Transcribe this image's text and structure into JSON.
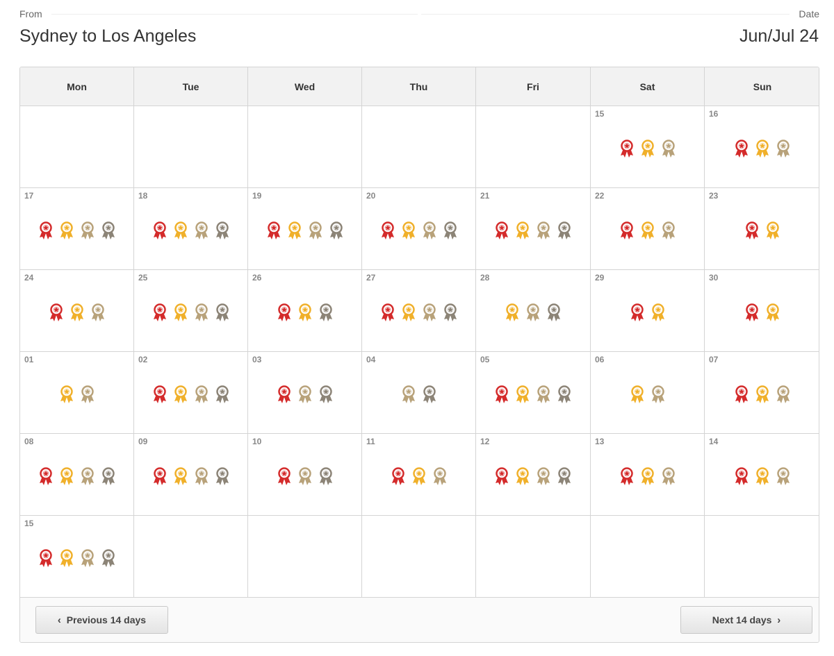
{
  "header": {
    "from_label": "From",
    "date_label": "Date",
    "route": "Sydney to Los Angeles",
    "period": "Jun/Jul 24"
  },
  "weekdays": [
    "Mon",
    "Tue",
    "Wed",
    "Thu",
    "Fri",
    "Sat",
    "Sun"
  ],
  "award_colors": {
    "first": "#d42b2b",
    "business": "#f0b02a",
    "premium": "#b8a27a",
    "economy": "#8c8477"
  },
  "award_icons": {
    "first": "award-red-icon",
    "business": "award-gold-icon",
    "premium": "award-tan-icon",
    "economy": "award-grey-icon"
  },
  "weeks": [
    [
      null,
      null,
      null,
      null,
      null,
      {
        "day": "15",
        "awards": [
          "first",
          "business",
          "premium"
        ]
      },
      {
        "day": "16",
        "awards": [
          "first",
          "business",
          "premium"
        ]
      }
    ],
    [
      {
        "day": "17",
        "awards": [
          "first",
          "business",
          "premium",
          "economy"
        ]
      },
      {
        "day": "18",
        "awards": [
          "first",
          "business",
          "premium",
          "economy"
        ]
      },
      {
        "day": "19",
        "awards": [
          "first",
          "business",
          "premium",
          "economy"
        ]
      },
      {
        "day": "20",
        "awards": [
          "first",
          "business",
          "premium",
          "economy"
        ]
      },
      {
        "day": "21",
        "awards": [
          "first",
          "business",
          "premium",
          "economy"
        ]
      },
      {
        "day": "22",
        "awards": [
          "first",
          "business",
          "premium"
        ]
      },
      {
        "day": "23",
        "awards": [
          "first",
          "business"
        ]
      }
    ],
    [
      {
        "day": "24",
        "awards": [
          "first",
          "business",
          "premium"
        ]
      },
      {
        "day": "25",
        "awards": [
          "first",
          "business",
          "premium",
          "economy"
        ]
      },
      {
        "day": "26",
        "awards": [
          "first",
          "business",
          "economy"
        ]
      },
      {
        "day": "27",
        "awards": [
          "first",
          "business",
          "premium",
          "economy"
        ]
      },
      {
        "day": "28",
        "awards": [
          "business",
          "premium",
          "economy"
        ]
      },
      {
        "day": "29",
        "awards": [
          "first",
          "business"
        ]
      },
      {
        "day": "30",
        "awards": [
          "first",
          "business"
        ]
      }
    ],
    [
      {
        "day": "01",
        "awards": [
          "business",
          "premium"
        ]
      },
      {
        "day": "02",
        "awards": [
          "first",
          "business",
          "premium",
          "economy"
        ]
      },
      {
        "day": "03",
        "awards": [
          "first",
          "premium",
          "economy"
        ]
      },
      {
        "day": "04",
        "awards": [
          "premium",
          "economy"
        ]
      },
      {
        "day": "05",
        "awards": [
          "first",
          "business",
          "premium",
          "economy"
        ]
      },
      {
        "day": "06",
        "awards": [
          "business",
          "premium"
        ]
      },
      {
        "day": "07",
        "awards": [
          "first",
          "business",
          "premium"
        ]
      }
    ],
    [
      {
        "day": "08",
        "awards": [
          "first",
          "business",
          "premium",
          "economy"
        ]
      },
      {
        "day": "09",
        "awards": [
          "first",
          "business",
          "premium",
          "economy"
        ]
      },
      {
        "day": "10",
        "awards": [
          "first",
          "premium",
          "economy"
        ]
      },
      {
        "day": "11",
        "awards": [
          "first",
          "business",
          "premium"
        ]
      },
      {
        "day": "12",
        "awards": [
          "first",
          "business",
          "premium",
          "economy"
        ]
      },
      {
        "day": "13",
        "awards": [
          "first",
          "business",
          "premium"
        ]
      },
      {
        "day": "14",
        "awards": [
          "first",
          "business",
          "premium"
        ]
      }
    ],
    [
      {
        "day": "15",
        "awards": [
          "first",
          "business",
          "premium",
          "economy"
        ]
      },
      null,
      null,
      null,
      null,
      null,
      null
    ]
  ],
  "footer": {
    "prev_icon": "chevron-left-icon",
    "prev_glyph": "‹",
    "prev_label": "Previous 14 days",
    "next_label": "Next 14 days",
    "next_glyph": "›",
    "next_icon": "chevron-right-icon"
  }
}
